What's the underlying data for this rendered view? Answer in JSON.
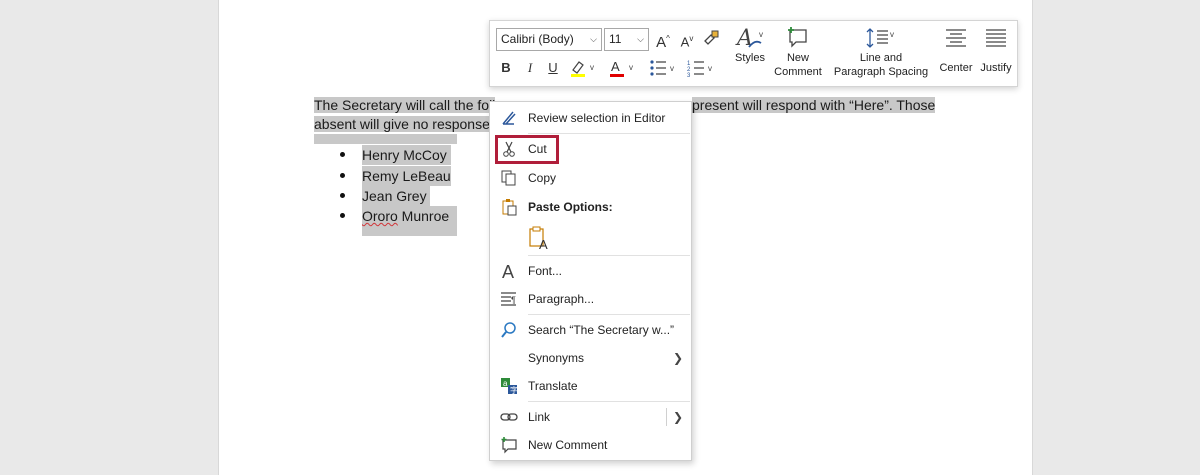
{
  "document": {
    "line1_sel_a": "The Secretary will call the foll",
    "line1_sel_b": "present will respond with “Here”. Those",
    "line2_sel": "absent will give no response.",
    "bullets": [
      "Henry McCoy",
      "Remy LeBeau",
      "Jean Grey",
      "Ororo Munroe"
    ]
  },
  "toolbar": {
    "font_name": "Calibri (Body)",
    "font_size": "11",
    "styles_label": "Styles",
    "new_comment_label_1": "New",
    "new_comment_label_2": "Comment",
    "line_spacing_label_1": "Line and",
    "line_spacing_label_2": "Paragraph Spacing",
    "center_label": "Center",
    "justify_label": "Justify",
    "bold_label": "B",
    "italic_label": "I",
    "underline_label": "U",
    "highlight_color": "#ffff00",
    "font_color": "#e00000"
  },
  "menu": {
    "review": "Review selection in Editor",
    "cut": "Cut",
    "copy": "Copy",
    "paste_options": "Paste Options:",
    "font": "Font...",
    "paragraph": "Paragraph...",
    "search": "Search “The Secretary w...”",
    "synonyms": "Synonyms",
    "translate": "Translate",
    "link": "Link",
    "new_comment": "New Comment"
  },
  "colors": {
    "selection": "#c8c8c8",
    "cut_highlight_border": "#b01e3a",
    "accent_blue": "#2b579a"
  }
}
